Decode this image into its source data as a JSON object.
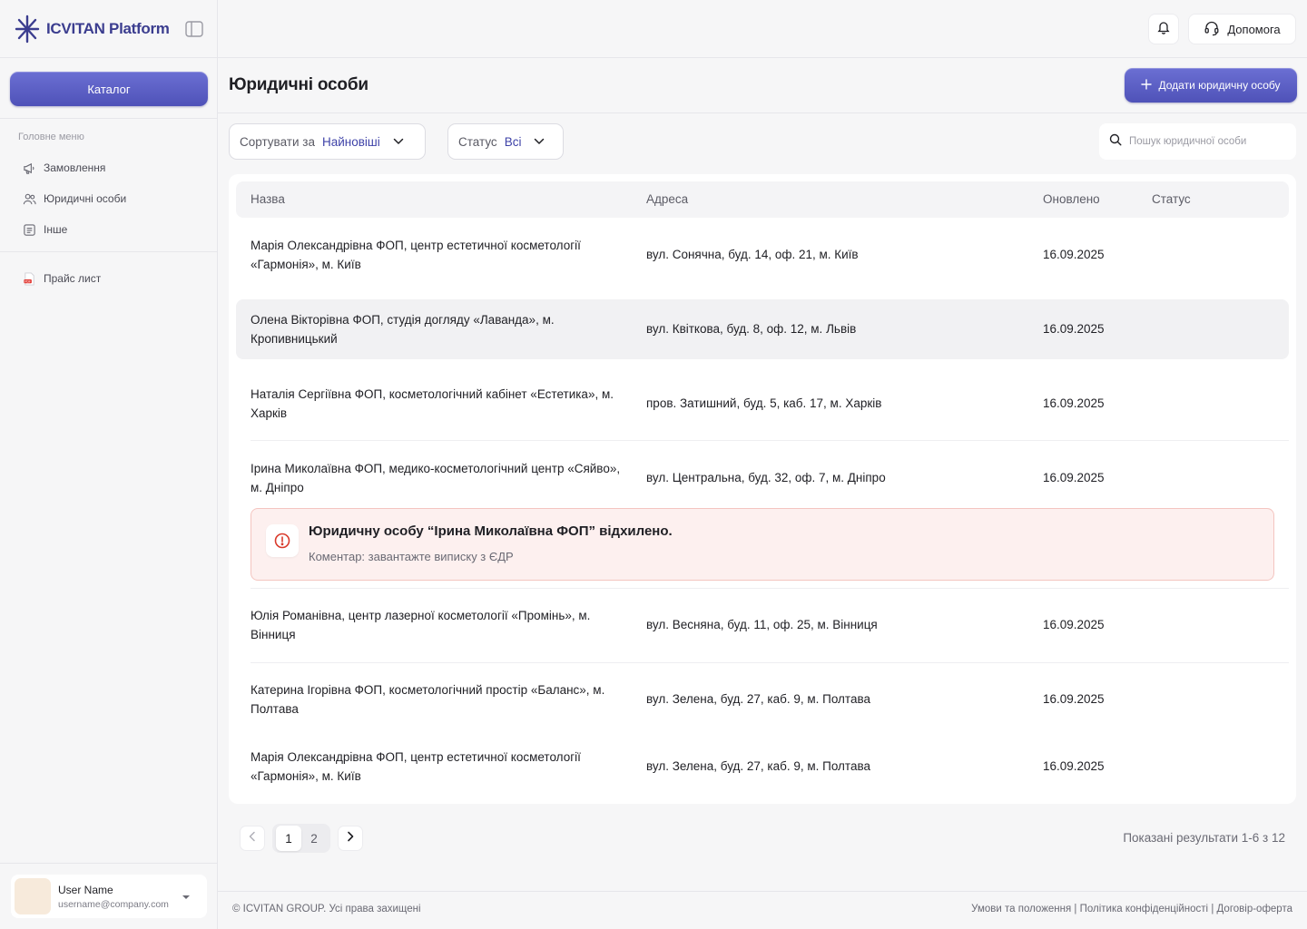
{
  "app": {
    "name": "ICVITAN Platform"
  },
  "sidebar": {
    "catalog_label": "Каталог",
    "menu_caption": "Головне меню",
    "items": [
      {
        "label": "Замовлення",
        "icon": "megaphone-icon"
      },
      {
        "label": "Юридичні особи",
        "icon": "users-icon"
      },
      {
        "label": "Інше",
        "icon": "list-icon"
      }
    ],
    "price_list": {
      "label": "Прайс лист",
      "icon": "pdf-icon"
    },
    "user": {
      "name": "User Name",
      "email": "username@company.com"
    }
  },
  "topbar": {
    "help_label": "Допомога"
  },
  "page": {
    "title": "Юридичні особи",
    "add_button": "Додати юридичну особу",
    "filters": {
      "sort_label": "Сортувати за",
      "sort_value": "Найновіші",
      "status_label": "Статус",
      "status_value": "Всі"
    },
    "search_placeholder": "Пошук юридичної особи"
  },
  "table": {
    "headers": {
      "name": "Назва",
      "address": "Адреса",
      "updated": "Оновлено",
      "status": "Статус"
    },
    "rows": [
      {
        "name": "Марія Олександрівна ФОП, центр естетичної косметології «Гармонія», м. Київ",
        "address": "вул. Сонячна, буд. 14, оф. 21, м. Київ",
        "updated": "16.09.2025"
      },
      {
        "name": "Олена Вікторівна ФОП, студія догляду «Лаванда», м. Кропивницький",
        "address": "вул. Квіткова, буд. 8, оф. 12, м. Львів",
        "updated": "16.09.2025"
      },
      {
        "name": "Наталія Сергіївна ФОП, косметологічний кабінет «Естетика», м. Харків",
        "address": "пров. Затишний, буд. 5, каб. 17, м. Харків",
        "updated": "16.09.2025"
      },
      {
        "name": "Ірина Миколаївна ФОП, медико-косметологічний центр «Сяйво», м. Дніпро",
        "address": "вул. Центральна, буд. 32, оф. 7, м. Дніпро",
        "updated": "16.09.2025"
      },
      {
        "name": "Юлія Романівна, центр лазерної косметології «Промінь», м. Вінниця",
        "address": "вул. Весняна, буд. 11, оф. 25, м. Вінниця",
        "updated": "16.09.2025"
      },
      {
        "name": "Катерина Ігорівна ФОП, косметологічний простір «Баланс», м. Полтава",
        "address": "вул. Зелена, буд. 27, каб. 9, м. Полтава",
        "updated": "16.09.2025"
      },
      {
        "name": "Марія Олександрівна ФОП, центр естетичної косметології «Гармонія», м. Київ",
        "address": "вул. Зелена, буд. 27, каб. 9, м. Полтава",
        "updated": "16.09.2025"
      }
    ],
    "alert": {
      "title": "Юридичну особу “Ірина Миколаївна ФОП” відхилено.",
      "comment": "Коментар: завантажте виписку з ЄДР"
    }
  },
  "pagination": {
    "pages": [
      "1",
      "2"
    ],
    "current": "1",
    "results": "Показані результати 1-6 з 12"
  },
  "footer": {
    "copyright": "© ICVITAN GROUP. Усі права захищені",
    "links": [
      "Умови та положення",
      "Політика конфіденційності",
      "Договір-оферта"
    ]
  },
  "colors": {
    "accent": "#5558c4",
    "alert_bg": "#fdf0ef",
    "alert_border": "#f4c5c0",
    "alert_icon": "#d93a2b"
  }
}
